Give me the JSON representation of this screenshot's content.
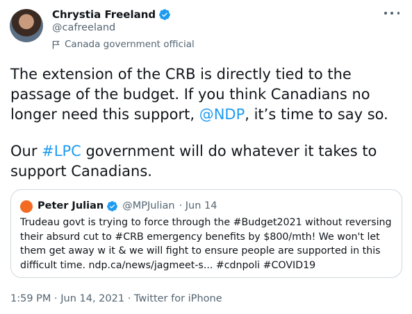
{
  "author": {
    "name": "Chrystia Freeland",
    "handle": "@cafreeland",
    "label": "Canada government official"
  },
  "tweet": {
    "line1_a": "The extension of the CRB is directly tied to the passage of the budget. If you think Canadians no longer need this support, ",
    "mention": "@NDP",
    "line1_b": ", it’s time to say so.",
    "line2_a": "Our ",
    "hashtag": "#LPC",
    "line2_b": " government will do whatever it takes to support Canadians."
  },
  "quote": {
    "name": "Peter Julian",
    "handle": "@MPJulian",
    "date": "· Jun 14",
    "text": "Trudeau govt is trying to force through the #Budget2021 without reversing their absurd cut to #CRB emergency benefits by $800/mth! We won't let them get away w it & we will fight to ensure people are supported in this difficult time. ndp.ca/news/jagmeet-s... #cdnpoli #COVID19"
  },
  "meta": {
    "time": "1:59 PM · Jun 14, 2021 · ",
    "source": "Twitter for iPhone"
  },
  "colors": {
    "link": "#1d9bf0",
    "verified": "#1d9bf0",
    "quote_avatar": "#f36a22"
  }
}
